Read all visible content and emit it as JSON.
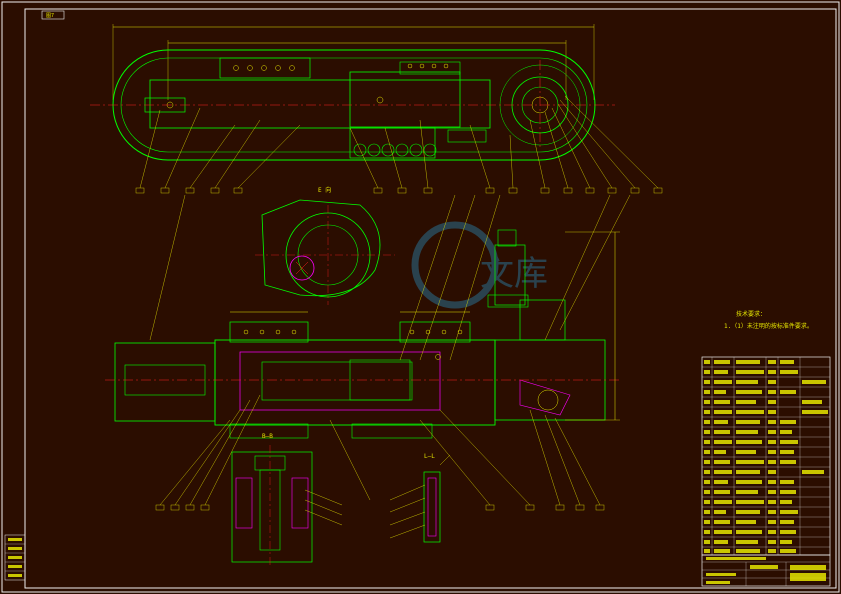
{
  "drawing": {
    "corner_tag": "图7",
    "section_label_top": "E 向",
    "section_label_mid": "B—B",
    "section_label_small": "L—L",
    "technical_requirements_title": "技术要求：",
    "technical_requirements_line": "1.（1）未注明的按标准件要求。"
  },
  "watermark": {
    "text": "文库",
    "color": "#2a6f8f"
  },
  "colors": {
    "background": "#2b0d00",
    "outline_green": "#00ff00",
    "dimension_yellow": "#e6e600",
    "center_red": "#ff2020",
    "hatch_magenta": "#ff00ff",
    "border_white": "#f0f0f0"
  },
  "title_block": {
    "rows": 20,
    "cols": 6
  },
  "side_stamps": [
    "审核",
    "校对",
    "设计",
    "标准化",
    "日期"
  ]
}
